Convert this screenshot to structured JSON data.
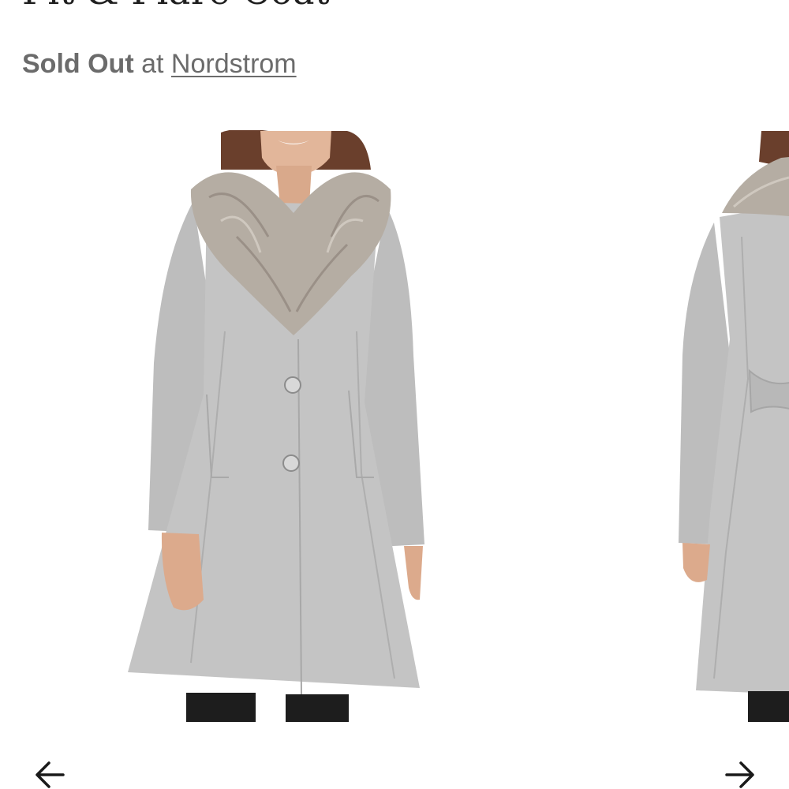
{
  "product": {
    "title": "Fit & Flare Coat"
  },
  "availability": {
    "status": "Sold Out",
    "at": "at",
    "retailer": "Nordstrom"
  },
  "carousel": {
    "slides": [
      {
        "view": "front",
        "coat_color": "#c4c4c4",
        "collar_color": "#b5ada3"
      },
      {
        "view": "side",
        "coat_color": "#c4c4c4",
        "collar_color": "#b5ada3"
      }
    ],
    "prev_icon": "arrow-left-icon",
    "next_icon": "arrow-right-icon"
  }
}
